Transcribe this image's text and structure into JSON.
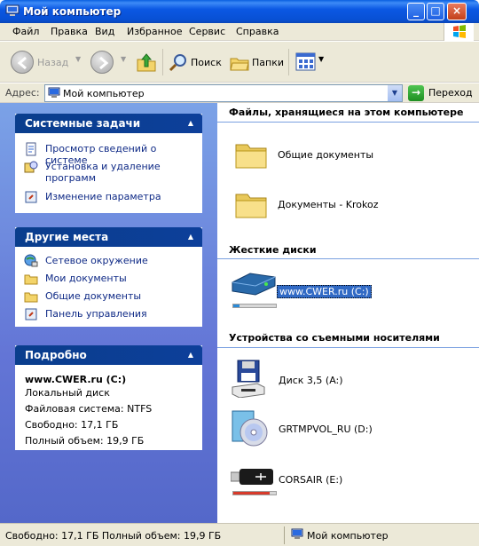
{
  "window": {
    "title": "Мой компьютер"
  },
  "menu": [
    "Файл",
    "Правка",
    "Вид",
    "Избранное",
    "Сервис",
    "Справка"
  ],
  "toolbar": {
    "back": "Назад",
    "search": "Поиск",
    "folders": "Папки"
  },
  "address": {
    "label": "Адрес:",
    "value": "Мой компьютер",
    "go": "Переход"
  },
  "system_tasks": {
    "title": "Системные задачи",
    "items": [
      "Просмотр сведений о системе",
      "Установка и удаление программ",
      "Изменение параметра"
    ]
  },
  "other_places": {
    "title": "Другие места",
    "items": [
      "Сетевое окружение",
      "Мои документы",
      "Общие документы",
      "Панель управления"
    ]
  },
  "details": {
    "title": "Подробно",
    "name": "www.CWER.ru (C:)",
    "type": "Локальный диск",
    "fs": "Файловая система: NTFS",
    "free": "Свободно: 17,1 ГБ",
    "total": "Полный объем: 19,9 ГБ"
  },
  "sections": {
    "stored_files": "Файлы, хранящиеся на этом компьютере",
    "hard_drives": "Жесткие диски",
    "removable": "Устройства со съемными носителями"
  },
  "stored_folders": [
    "Общие документы",
    "Документы - Krokoz"
  ],
  "hard_drive": {
    "label": "www.CWER.ru (C:)",
    "used_fraction": 0.14
  },
  "removable_devices": [
    {
      "label": "Диск 3,5 (A:)"
    },
    {
      "label": "GRTMPVOL_RU (D:)"
    },
    {
      "label": "CORSAIR (E:)",
      "used_fraction": 0.85
    }
  ],
  "status": {
    "left": "Свободно: 17,1 ГБ Полный объем: 19,9 ГБ",
    "right": "Мой компьютер"
  },
  "colors": {
    "titlebar": "#0a52dd",
    "task_pane": "#6d8be0",
    "panel_header": "#0d3f9a",
    "selection": "#316ac5"
  }
}
